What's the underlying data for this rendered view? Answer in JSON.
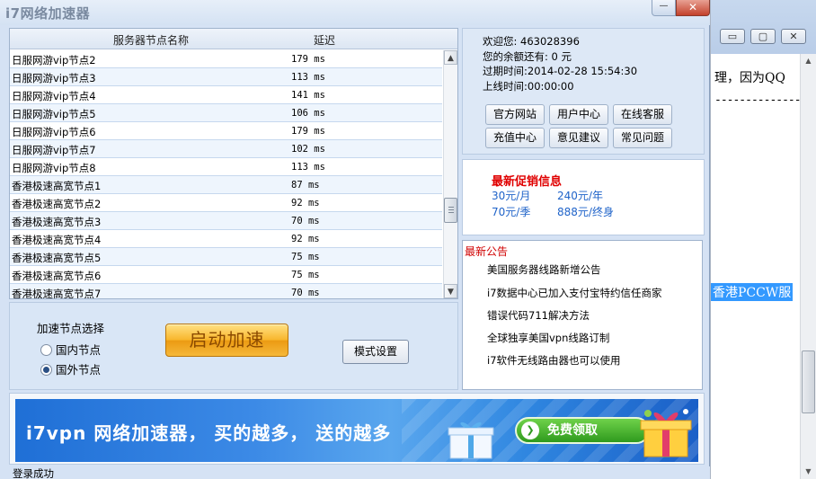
{
  "app": {
    "title": "i7网络加速器",
    "minimize_glyph": "—",
    "close_glyph": "✕"
  },
  "server_list": {
    "columns": [
      "服务器节点名称",
      "延迟"
    ],
    "rows": [
      {
        "name": "日服网游vip节点2",
        "latency": "179 ms"
      },
      {
        "name": "日服网游vip节点3",
        "latency": "113 ms"
      },
      {
        "name": "日服网游vip节点4",
        "latency": "141 ms"
      },
      {
        "name": "日服网游vip节点5",
        "latency": "106 ms"
      },
      {
        "name": "日服网游vip节点6",
        "latency": "179 ms"
      },
      {
        "name": "日服网游vip节点7",
        "latency": "102 ms"
      },
      {
        "name": "日服网游vip节点8",
        "latency": "113 ms"
      },
      {
        "name": "香港极速高宽节点1",
        "latency": "87 ms"
      },
      {
        "name": "香港极速高宽节点2",
        "latency": "92 ms"
      },
      {
        "name": "香港极速高宽节点3",
        "latency": "70 ms"
      },
      {
        "name": "香港极速高宽节点4",
        "latency": "92 ms"
      },
      {
        "name": "香港极速高宽节点5",
        "latency": "75 ms"
      },
      {
        "name": "香港极速高宽节点6",
        "latency": "75 ms"
      },
      {
        "name": "香港极速高宽节点7",
        "latency": "70 ms"
      }
    ]
  },
  "node_select": {
    "label": "加速节点选择",
    "options": [
      "国内节点",
      "国外节点"
    ],
    "selected": "国外节点"
  },
  "buttons": {
    "start": "启动加速",
    "mode": "模式设置"
  },
  "user": {
    "welcome": "欢迎您: 463028396",
    "balance": "您的余额还有: 0 元",
    "expire": "过期时间:2014-02-28 15:54:30",
    "online": "上线时间:00:00:00",
    "links": [
      "官方网站",
      "用户中心",
      "在线客服",
      "充值中心",
      "意见建议",
      "常见问题"
    ]
  },
  "promo": {
    "title": "最新促销信息",
    "prices": [
      "30元/月",
      "240元/年",
      "70元/季",
      "888元/终身"
    ]
  },
  "notice": {
    "title": "最新公告",
    "items": [
      "美国服务器线路新增公告",
      "i7数据中心已加入支付宝特约信任商家",
      "错误代码711解决方法",
      "全球独享美国vpn线路订制",
      "i7软件无线路由器也可以使用"
    ]
  },
  "banner": {
    "text": "i7vpn 网络加速器，  买的越多，  送的越多",
    "button": "免费领取"
  },
  "status": "登录成功",
  "background_window": {
    "text_line": "理，因为QQ",
    "dashes": "--------------",
    "highlight": "香港PCCW服"
  },
  "colors": {
    "window_bg": "#d5e2f4",
    "promo_title": "#e00000",
    "price_blue": "#1f63c9",
    "start_button": "#f8b52b"
  }
}
